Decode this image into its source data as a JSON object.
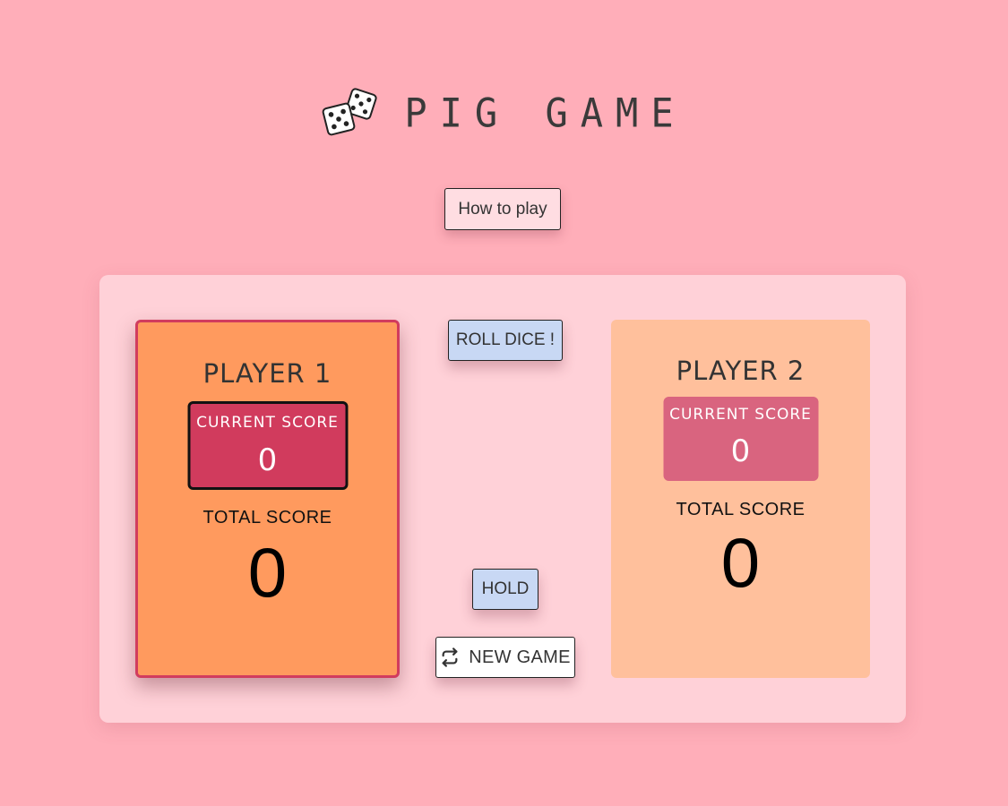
{
  "header": {
    "title": "PIG GAME",
    "icon": "dice-icon"
  },
  "how_to_play": {
    "label": "How to play"
  },
  "controls": {
    "roll_label": "ROLL DICE !",
    "hold_label": "HOLD",
    "new_game_label": "NEW GAME",
    "new_game_icon": "swap-icon"
  },
  "players": [
    {
      "name": "PLAYER 1",
      "current_label": "CURRENT SCORE",
      "current_score": "0",
      "total_label": "TOTAL SCORE",
      "total_score": "0",
      "active": true
    },
    {
      "name": "PLAYER 2",
      "current_label": "CURRENT SCORE",
      "current_score": "0",
      "total_label": "TOTAL SCORE",
      "total_score": "0",
      "active": false
    }
  ],
  "colors": {
    "background": "#ffaeb9",
    "board": "#ffd1d8",
    "active_player": "#ff9a5e",
    "inactive_player": "#ffc09c",
    "active_current": "#d13b5d",
    "inactive_current": "#d9647f",
    "action_button": "#c8d8f4"
  }
}
